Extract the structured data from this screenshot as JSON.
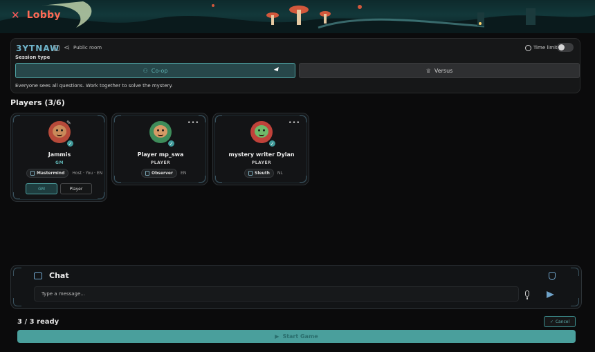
{
  "header": {
    "close_icon": "x-icon",
    "title": "Lobby"
  },
  "room": {
    "code": "3YTNAW",
    "visibility": "Public room",
    "time_limit_label": "Time limit",
    "time_limit_enabled": false,
    "session_type_label": "Session type",
    "modes": [
      {
        "label": "Co-op",
        "icon": "people-icon",
        "selected": true
      },
      {
        "label": "Versus",
        "icon": "trophy-icon",
        "selected": false
      }
    ],
    "mode_description": "Everyone sees all questions. Work together to solve the mystery."
  },
  "players": {
    "heading": "Players (3/6)",
    "list": [
      {
        "name": "Jammis",
        "role": "GM",
        "tag": "Mastermind",
        "meta": "Host · You · EN",
        "ready": true,
        "buttons": [
          "GM",
          "Player"
        ]
      },
      {
        "name": "Player mp_swa",
        "role": "PLAYER",
        "tag": "Observer",
        "meta": "EN",
        "ready": true
      },
      {
        "name": "mystery writer Dylan",
        "role": "PLAYER",
        "tag": "Sleuth",
        "meta": "NL",
        "ready": true
      }
    ]
  },
  "chat": {
    "title": "Chat",
    "placeholder": "Type a message..."
  },
  "footer": {
    "ready_status": "3 / 3 ready",
    "cancel_label": "Cancel",
    "start_label": "Start Game"
  },
  "colors": {
    "accent": "#4fa3a3",
    "danger": "#ff5a5a",
    "background": "#0b0b0c"
  }
}
